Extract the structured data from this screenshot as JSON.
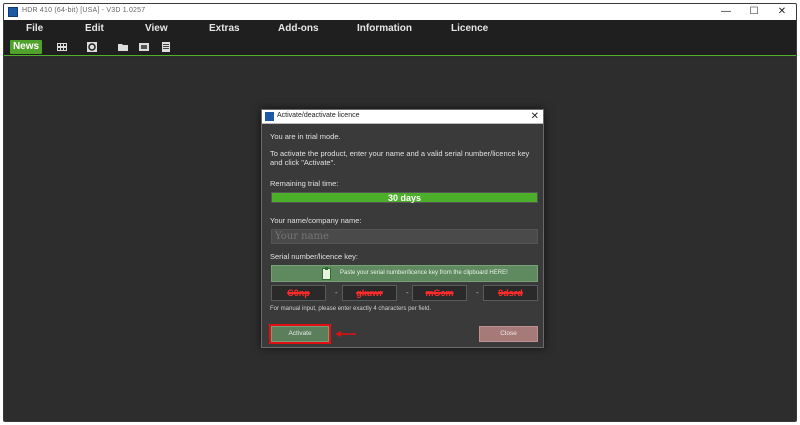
{
  "app": {
    "title": "HDR 410 (64-bit) [USA] - V3D 1.0257",
    "window_controls": {
      "minimize": "—",
      "maximize": "☐",
      "close": "✕"
    }
  },
  "menu": [
    "File",
    "Edit",
    "View",
    "Extras",
    "Add-ons",
    "Information",
    "Licence"
  ],
  "toolbar": {
    "news_label": "News",
    "icons": [
      "film-icon",
      "settings-circle-icon",
      "folder-icon",
      "image-folder-icon",
      "document-icon"
    ]
  },
  "dialog": {
    "title": "Activate/deactivate licence",
    "close_glyph": "✕",
    "trial_mode_text": "You are in trial mode.",
    "instructions": "To activate the product, enter your name and a valid serial number/licence key and click \"Activate\".",
    "remaining_label": "Remaining trial time:",
    "remaining_value": "30 days",
    "remaining_fraction": 1.0,
    "name_label": "Your name/company name:",
    "name_placeholder": "Your name",
    "serial_label": "Serial number/licence key:",
    "paste_label": "Paste your serial number/licence key from the clipboard HERE!",
    "serial_parts": [
      "C0np",
      "gkuwr",
      "mGcm",
      "9dsrd"
    ],
    "serial_separator": "-",
    "manual_hint": "For manual input, please enter exactly 4 characters per field.",
    "activate_label": "Activate",
    "close_label": "Close"
  },
  "colors": {
    "accent_green": "#4caf2a",
    "annotation_red": "#e01010"
  }
}
